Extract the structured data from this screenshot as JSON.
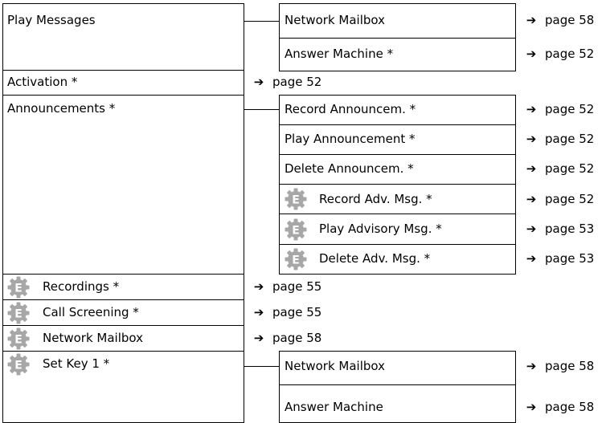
{
  "colors": {
    "border": "#000000",
    "icon_fill": "#a7a7a7",
    "icon_letter": "#ffffff",
    "text": "#000000"
  },
  "icon": {
    "name": "expert-mode-gear-icon",
    "letter": "E"
  },
  "menu": {
    "play_messages": {
      "label": "Play Messages",
      "sub": [
        {
          "label": "Network Mailbox",
          "page": "page 58"
        },
        {
          "label": "Answer Machine *",
          "page": "page 52"
        }
      ]
    },
    "activation": {
      "label": "Activation *",
      "page": "page 52"
    },
    "announcements": {
      "label": "Announcements *",
      "sub": [
        {
          "label": "Record Announcem. *",
          "page": "page 52"
        },
        {
          "label": "Play Announcement *",
          "page": "page 52"
        },
        {
          "label": "Delete Announcem. *",
          "page": "page 52"
        },
        {
          "label": "Record Adv. Msg. *",
          "page": "page 52"
        },
        {
          "label": "Play Advisory Msg. *",
          "page": "page 53"
        },
        {
          "label": "Delete Adv. Msg. *",
          "page": "page 53"
        }
      ]
    },
    "recordings": {
      "label": "Recordings *",
      "page": "page 55"
    },
    "call_screening": {
      "label": "Call Screening *",
      "page": "page 55"
    },
    "network_mailbox": {
      "label": "Network Mailbox",
      "page": "page 58"
    },
    "set_key_1": {
      "label": "Set Key 1 *",
      "sub": [
        {
          "label": "Network Mailbox",
          "page": "page 58"
        },
        {
          "label": "Answer Machine",
          "page": "page 58"
        }
      ]
    }
  }
}
